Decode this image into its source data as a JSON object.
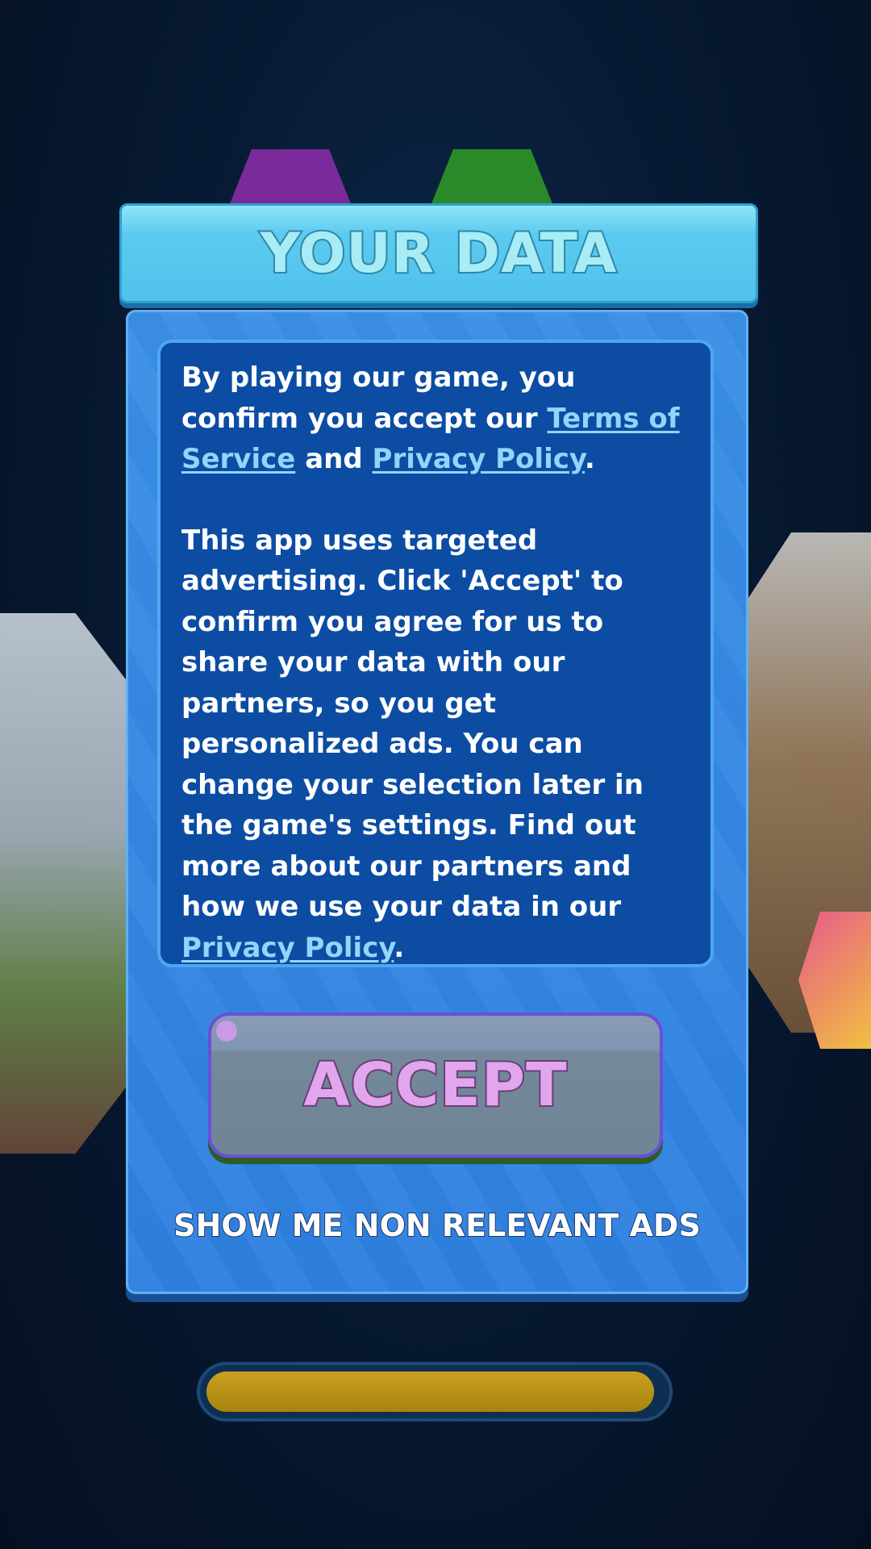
{
  "dialog": {
    "title": "YOUR DATA",
    "consent_intro_1": "By playing our game, you confirm you accept our ",
    "terms_link": "Terms of Service",
    "consent_intro_2": " and ",
    "privacy_link_1": "Privacy Policy",
    "consent_intro_3": ".",
    "ads_paragraph": "This app uses targeted advertising. Click 'Accept' to confirm you agree for us to share your data with our partners, so you get personalized ads. You can change your selection later in the game's settings. Find out more about our partners and how we use your data in our ",
    "privacy_link_2": "Privacy Policy",
    "ads_paragraph_end": ".",
    "accept_label": "ACCEPT",
    "non_relevant_label": "SHOW ME NON RELEVANT ADS"
  },
  "loading": {
    "progress": 0.98
  },
  "colors": {
    "header": "#5ccaf0",
    "panel": "#2f80e0",
    "text_box": "#0c4da3",
    "link": "#8fd6fa",
    "accept_text": "#e2a6ec",
    "progress_fill": "#c9a020"
  }
}
